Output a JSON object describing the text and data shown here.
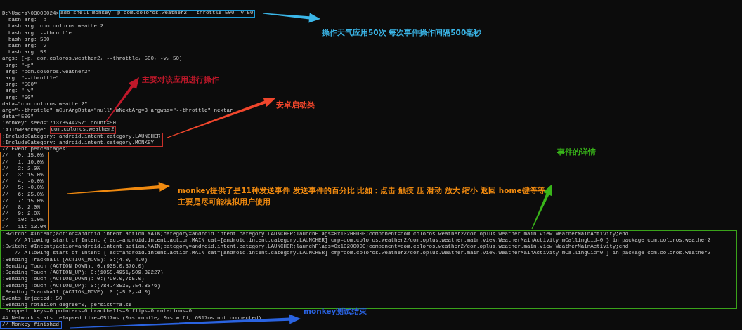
{
  "terminal": {
    "lines": [
      {
        "kind": "highlight",
        "text": "D:\\Users\\08000024>",
        "highlight": "adb shell monkey -p com.coloros.weather2 --throttle 500 -v 50",
        "color": "#1e9bd7"
      },
      "  bash arg: -p",
      "  bash arg: com.coloros.weather2",
      "  bash arg: --throttle",
      "  bash arg: 500",
      "  bash arg: -v",
      "  bash arg: 50",
      "args: [-p, com.coloros.weather2, --throttle, 500, -v, 50]",
      " arg: \"-p\"",
      " arg: \"com.coloros.weather2\"",
      " arg: \"--throttle\"",
      " arg: \"500\"",
      " arg: \"-v\"",
      " arg: \"50\"",
      "data=\"com.coloros.weather2\"",
      "arg=\"--throttle\" mCurArgData=\"null\" mNextArg=3 argwas=\"--throttle\" nextar",
      "data=\"500\"",
      ":Monkey: seed=1713785442571 count=50",
      {
        "kind": "highlight",
        "text": ":AllowPackage: ",
        "highlight": "com.coloros.weather2",
        "color": "#b02a2a"
      },
      {
        "kind": "box",
        "color": "#c8302a",
        "lines": [
          ":IncludeCategory: android.intent.category.LAUNCHER",
          ":IncludeCategory: android.intent.category.MONKEY"
        ]
      },
      "// Event percentages:",
      {
        "kind": "box",
        "color": "#d87a18",
        "lines": [
          "//   0: 15.0%",
          "//   1: 10.0%",
          "//   2: 2.0%",
          "//   3: 15.0%",
          "//   4: -0.0%",
          "//   5: -0.0%",
          "//   6: 25.0%",
          "//   7: 15.0%",
          "//   8: 2.0%",
          "//   9: 2.0%",
          "//   10: 1.0%",
          "//   11: 13.0%"
        ]
      },
      {
        "kind": "box",
        "color": "#3aa31a",
        "lines": [
          ":Switch: #Intent;action=android.intent.action.MAIN;category=android.intent.category.LAUNCHER;launchFlags=0x10200000;component=com.coloros.weather2/com.oplus.weather.main.view.WeatherMainActivity;end",
          "    // Allowing start of Intent { act=android.intent.action.MAIN cat=[android.intent.category.LAUNCHER] cmp=com.coloros.weather2/com.oplus.weather.main.view.WeatherMainActivity mCallingUid=0 } in package com.coloros.weather2",
          ":Switch: #Intent;action=android.intent.action.MAIN;category=android.intent.category.LAUNCHER;launchFlags=0x10200000;component=com.coloros.weather2/com.oplus.weather.main.view.WeatherMainActivity;end",
          "    // Allowing start of Intent { act=android.intent.action.MAIN cat=[android.intent.category.LAUNCHER] cmp=com.coloros.weather2/com.oplus.weather.main.view.WeatherMainActivity mCallingUid=0 } in package com.coloros.weather2",
          ":Sending Trackball (ACTION_MOVE): 0:(4.0,-4.0)",
          ":Sending Touch (ACTION_DOWN): 0:(935.0,376.0)",
          ":Sending Touch (ACTION_UP): 0:(1055.4951,509.32227)",
          ":Sending Touch (ACTION_DOWN): 0:(790.0,765.0)",
          ":Sending Touch (ACTION_UP): 0:(784.48535,754.8076)",
          ":Sending Trackball (ACTION_MOVE): 0:(-5.0,-4.0)",
          "Events injected: 50",
          ":Sending rotation degree=0, persist=false"
        ]
      },
      ":Dropped: keys=0 pointers=0 trackballs=0 flips=0 rotations=0",
      "## Network stats: elapsed time=6517ms (0ms mobile, 0ms wifi, 6517ms not connected)",
      {
        "kind": "box",
        "color": "#2a63e0",
        "lines": [
          "// Monkey finished"
        ]
      }
    ]
  },
  "annotations": [
    {
      "lines": [
        "操作天气应用50次 每次事件操作间隔500毫秒"
      ],
      "color": "#3bb6e8"
    },
    {
      "lines": [
        "主要对该应用进行操作"
      ],
      "color": "#c0182a"
    },
    {
      "lines": [
        "安卓启动类"
      ],
      "color": "#f0462c"
    },
    {
      "lines": [
        "事件的详情"
      ],
      "color": "#39b51a"
    },
    {
      "lines": [
        "monkey提供了是11种发送事件 发送事件的百分比 比如：点击 触摸 压 滑动 放大 缩小 返回 home键等等",
        "主要是尽可能模拟用户使用"
      ],
      "color": "#f08a10"
    },
    {
      "lines": [
        "monkey测试结束"
      ],
      "color": "#2a63e0"
    }
  ]
}
